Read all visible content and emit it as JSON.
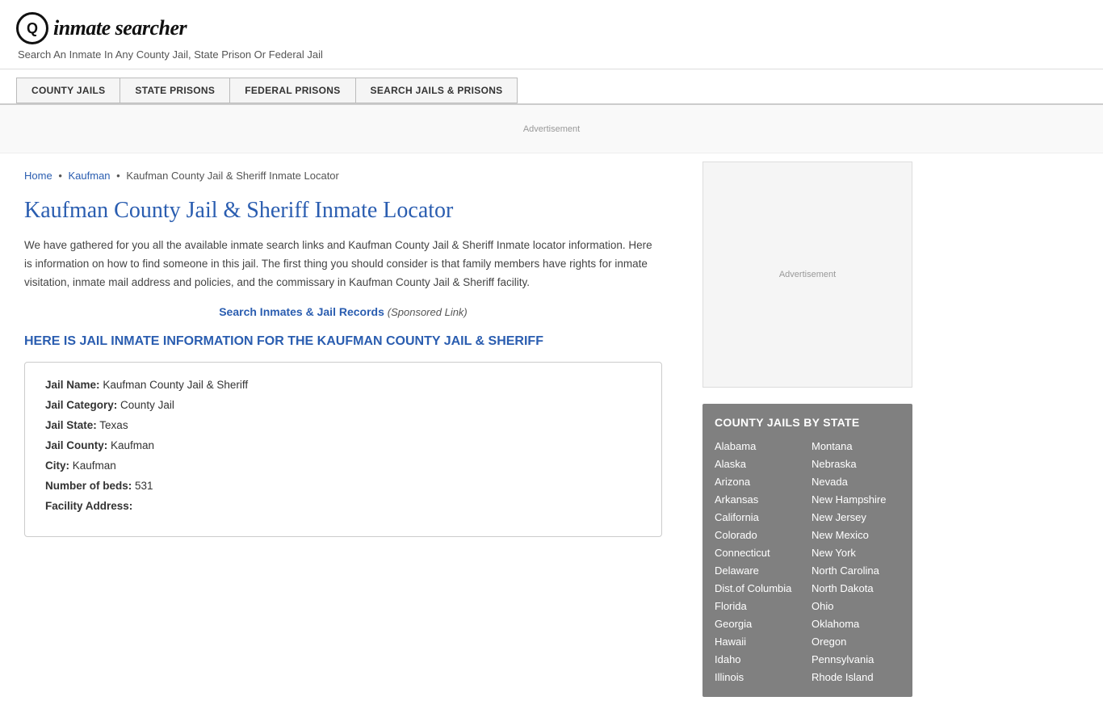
{
  "header": {
    "logo_icon": "🔍",
    "logo_text_prefix": "inmate",
    "logo_text_suffix": "searcher",
    "tagline": "Search An Inmate In Any County Jail, State Prison Or Federal Jail"
  },
  "nav": {
    "items": [
      {
        "label": "COUNTY JAILS",
        "id": "county-jails"
      },
      {
        "label": "STATE PRISONS",
        "id": "state-prisons"
      },
      {
        "label": "FEDERAL PRISONS",
        "id": "federal-prisons"
      },
      {
        "label": "SEARCH JAILS & PRISONS",
        "id": "search-jails"
      }
    ]
  },
  "ad": {
    "label": "Advertisement"
  },
  "breadcrumb": {
    "home": "Home",
    "parent": "Kaufman",
    "current": "Kaufman County Jail & Sheriff Inmate Locator"
  },
  "page": {
    "title": "Kaufman County Jail & Sheriff Inmate Locator",
    "description": "We have gathered for you all the available inmate search links and Kaufman County Jail & Sheriff Inmate locator information. Here is information on how to find someone in this jail. The first thing you should consider is that family members have rights for inmate visitation, inmate mail address and policies, and the commissary in Kaufman County Jail & Sheriff facility.",
    "sponsored_link_text": "Search Inmates & Jail Records",
    "sponsored_link_suffix": "(Sponsored Link)",
    "section_heading": "HERE IS JAIL INMATE INFORMATION FOR THE KAUFMAN COUNTY JAIL & SHERIFF"
  },
  "jail_info": {
    "fields": [
      {
        "label": "Jail Name:",
        "value": "Kaufman County Jail & Sheriff"
      },
      {
        "label": "Jail Category:",
        "value": "County Jail"
      },
      {
        "label": "Jail State:",
        "value": "Texas"
      },
      {
        "label": "Jail County:",
        "value": "Kaufman"
      },
      {
        "label": "City:",
        "value": "Kaufman"
      },
      {
        "label": "Number of beds:",
        "value": "531"
      },
      {
        "label": "Facility Address:",
        "value": ""
      }
    ]
  },
  "sidebar": {
    "ad_label": "Advertisement",
    "state_box": {
      "title": "COUNTY JAILS BY STATE",
      "left_column": [
        "Alabama",
        "Alaska",
        "Arizona",
        "Arkansas",
        "California",
        "Colorado",
        "Connecticut",
        "Delaware",
        "Dist.of Columbia",
        "Florida",
        "Georgia",
        "Hawaii",
        "Idaho",
        "Illinois"
      ],
      "right_column": [
        "Montana",
        "Nebraska",
        "Nevada",
        "New Hampshire",
        "New Jersey",
        "New Mexico",
        "New York",
        "North Carolina",
        "North Dakota",
        "Ohio",
        "Oklahoma",
        "Oregon",
        "Pennsylvania",
        "Rhode Island"
      ]
    }
  }
}
